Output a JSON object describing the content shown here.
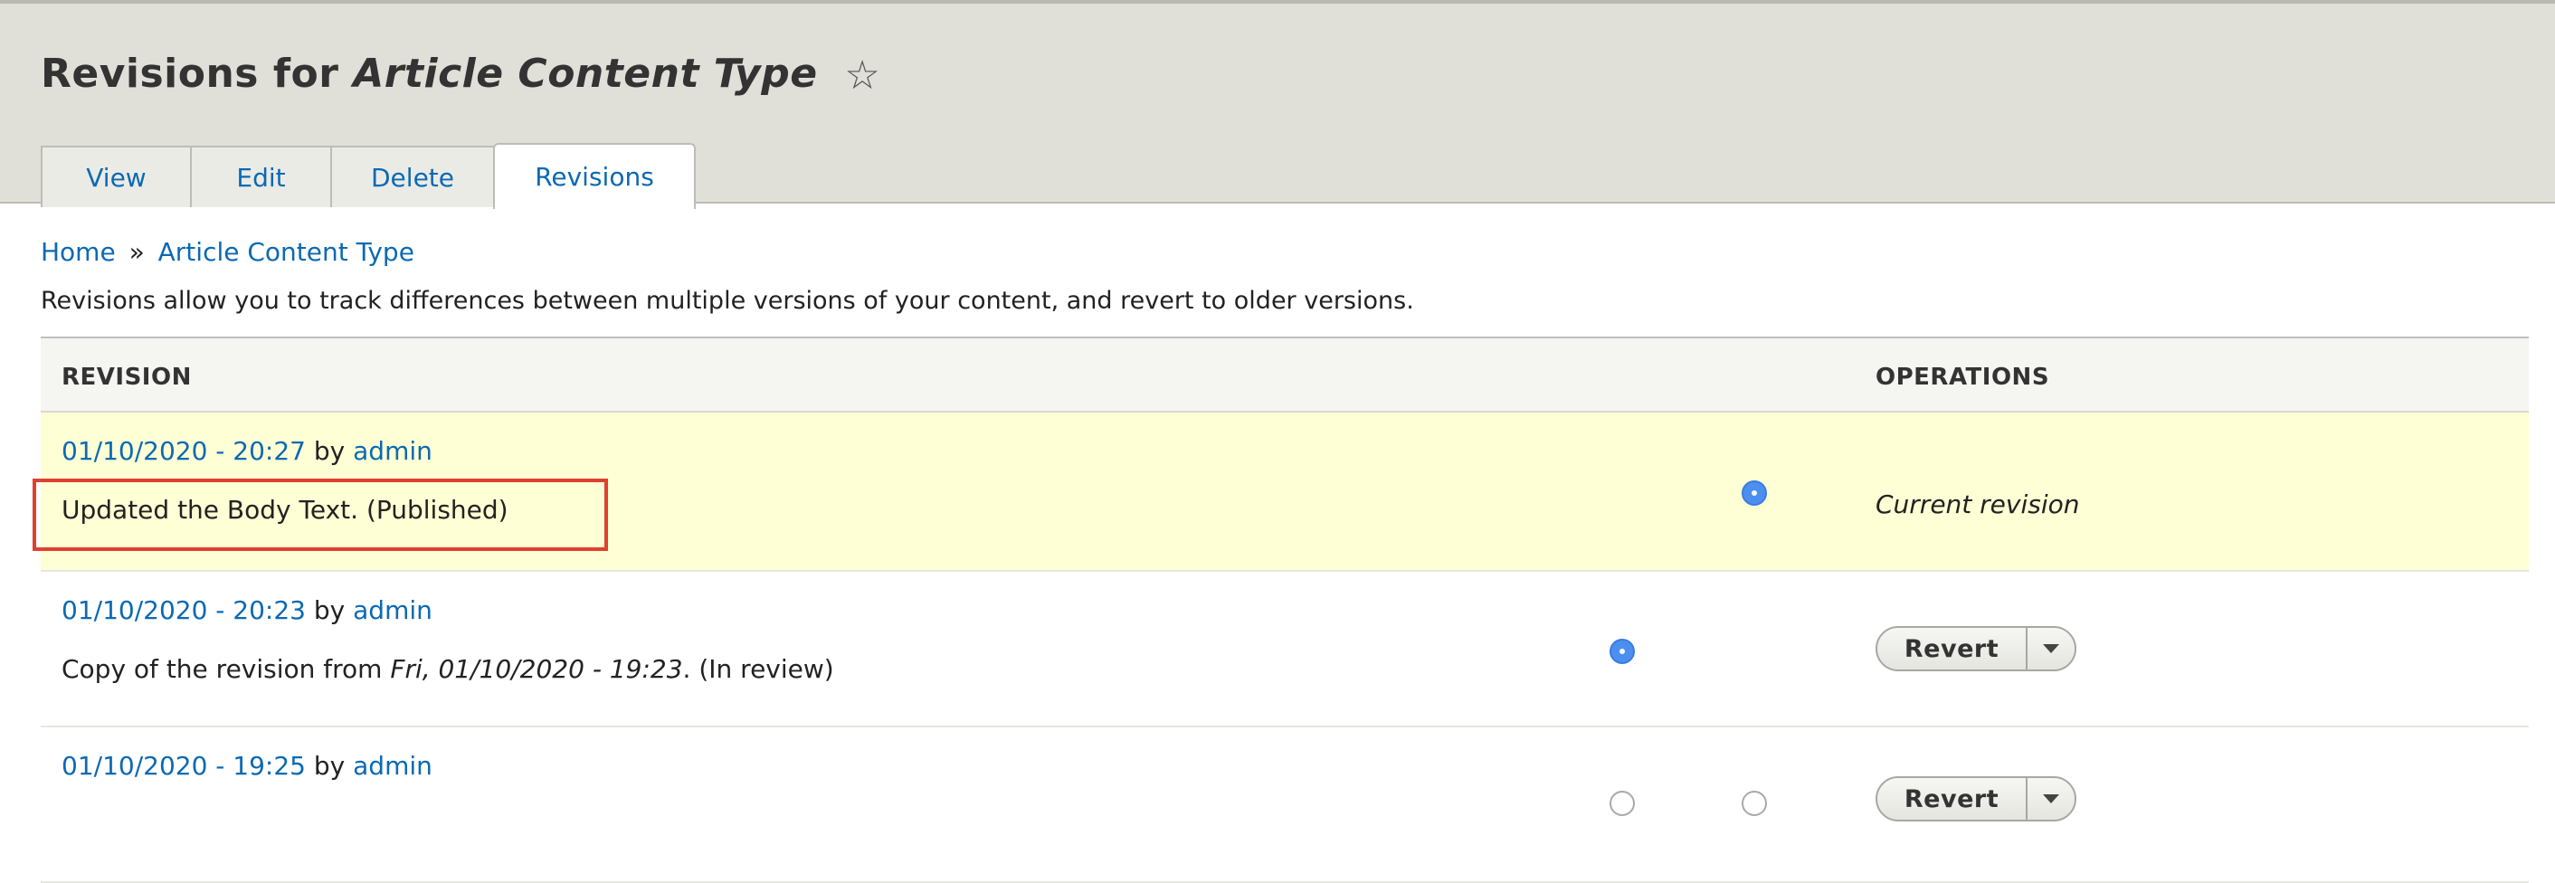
{
  "header": {
    "title_prefix": "Revisions for",
    "title_entity": "Article Content Type",
    "star_glyph": "☆"
  },
  "tabs": [
    {
      "label": "View",
      "active": false
    },
    {
      "label": "Edit",
      "active": false
    },
    {
      "label": "Delete",
      "active": false
    },
    {
      "label": "Revisions",
      "active": true
    }
  ],
  "breadcrumb": {
    "home": "Home",
    "separator": "»",
    "current": "Article Content Type"
  },
  "description": "Revisions allow you to track differences between multiple versions of your content, and revert to older versions.",
  "table": {
    "headers": {
      "revision": "REVISION",
      "operations": "OPERATIONS"
    },
    "rows": [
      {
        "date": "01/10/2020 - 20:27",
        "by": "by",
        "author": "admin",
        "message": "Updated the Body Text. (Published)",
        "operation": "Current revision"
      },
      {
        "date": "01/10/2020 - 20:23",
        "by": "by",
        "author": "admin",
        "message_prefix": "Copy of the revision from",
        "message_em": "Fri, 01/10/2020 - 19:23",
        "message_suffix": ". (In review)",
        "operation": "Revert"
      },
      {
        "date": "01/10/2020 - 19:25",
        "by": "by",
        "author": "admin",
        "operation": "Revert"
      }
    ]
  },
  "colors": {
    "link": "#0b69b3",
    "current_row": "#ffffd5",
    "header_band": "#e0dfd8",
    "highlight": "#e0402e",
    "radio_selected": "#4c8ff0"
  }
}
